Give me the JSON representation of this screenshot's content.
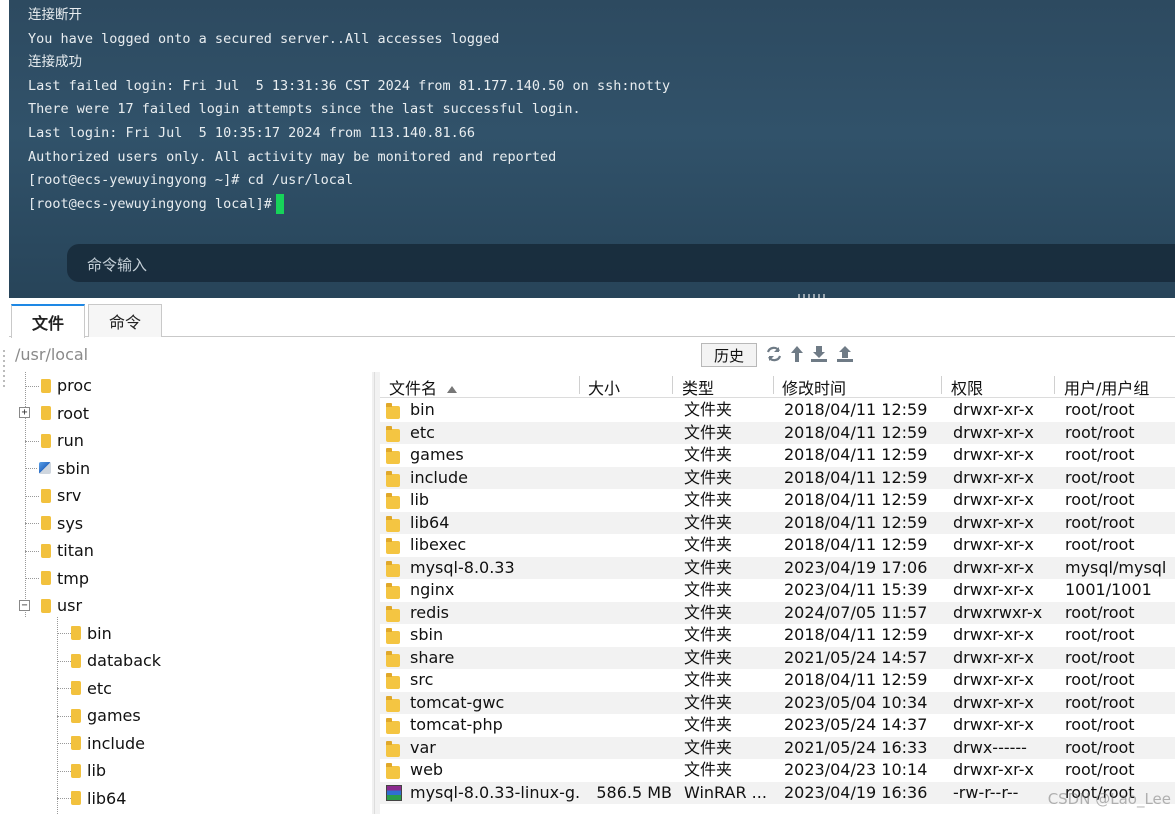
{
  "terminal": {
    "lines": [
      "连接断开",
      "You have logged onto a secured server..All accesses logged",
      "连接成功",
      "Last failed login: Fri Jul  5 13:31:36 CST 2024 from 81.177.140.50 on ssh:notty",
      "There were 17 failed login attempts since the last successful login.",
      "Last login: Fri Jul  5 10:35:17 2024 from 113.140.81.66",
      "Authorized users only. All activity may be monitored and reported",
      "[root@ecs-yewuyingyong ~]# cd /usr/local",
      "[root@ecs-yewuyingyong local]#"
    ],
    "command_placeholder": "命令输入",
    "cursor_color": "#17d35a"
  },
  "tabs": {
    "file": "文件",
    "command": "命令"
  },
  "pathbar": {
    "path": "/usr/local",
    "history_label": "历史"
  },
  "icons": {
    "refresh": "refresh-icon",
    "up": "arrow-up-icon",
    "download": "download-icon",
    "upload": "upload-icon"
  },
  "tree": {
    "items": [
      {
        "label": "proc"
      },
      {
        "label": "root"
      },
      {
        "label": "run"
      },
      {
        "label": "sbin"
      },
      {
        "label": "srv"
      },
      {
        "label": "sys"
      },
      {
        "label": "titan"
      },
      {
        "label": "tmp"
      },
      {
        "label": "usr"
      },
      {
        "label": "bin"
      },
      {
        "label": "databack"
      },
      {
        "label": "etc"
      },
      {
        "label": "games"
      },
      {
        "label": "include"
      },
      {
        "label": "lib"
      },
      {
        "label": "lib64"
      }
    ]
  },
  "filelist": {
    "columns": {
      "name": "文件名",
      "size": "大小",
      "type": "类型",
      "modified": "修改时间",
      "permissions": "权限",
      "owner": "用户/用户组"
    },
    "rows": [
      {
        "name": "bin",
        "size": "",
        "type": "文件夹",
        "modified": "2018/04/11 12:59",
        "permissions": "drwxr-xr-x",
        "owner": "root/root"
      },
      {
        "name": "etc",
        "size": "",
        "type": "文件夹",
        "modified": "2018/04/11 12:59",
        "permissions": "drwxr-xr-x",
        "owner": "root/root"
      },
      {
        "name": "games",
        "size": "",
        "type": "文件夹",
        "modified": "2018/04/11 12:59",
        "permissions": "drwxr-xr-x",
        "owner": "root/root"
      },
      {
        "name": "include",
        "size": "",
        "type": "文件夹",
        "modified": "2018/04/11 12:59",
        "permissions": "drwxr-xr-x",
        "owner": "root/root"
      },
      {
        "name": "lib",
        "size": "",
        "type": "文件夹",
        "modified": "2018/04/11 12:59",
        "permissions": "drwxr-xr-x",
        "owner": "root/root"
      },
      {
        "name": "lib64",
        "size": "",
        "type": "文件夹",
        "modified": "2018/04/11 12:59",
        "permissions": "drwxr-xr-x",
        "owner": "root/root"
      },
      {
        "name": "libexec",
        "size": "",
        "type": "文件夹",
        "modified": "2018/04/11 12:59",
        "permissions": "drwxr-xr-x",
        "owner": "root/root"
      },
      {
        "name": "mysql-8.0.33",
        "size": "",
        "type": "文件夹",
        "modified": "2023/04/19 17:06",
        "permissions": "drwxr-xr-x",
        "owner": "mysql/mysql"
      },
      {
        "name": "nginx",
        "size": "",
        "type": "文件夹",
        "modified": "2023/04/11 15:39",
        "permissions": "drwxr-xr-x",
        "owner": "1001/1001"
      },
      {
        "name": "redis",
        "size": "",
        "type": "文件夹",
        "modified": "2024/07/05 11:57",
        "permissions": "drwxrwxr-x",
        "owner": "root/root"
      },
      {
        "name": "sbin",
        "size": "",
        "type": "文件夹",
        "modified": "2018/04/11 12:59",
        "permissions": "drwxr-xr-x",
        "owner": "root/root"
      },
      {
        "name": "share",
        "size": "",
        "type": "文件夹",
        "modified": "2021/05/24 14:57",
        "permissions": "drwxr-xr-x",
        "owner": "root/root"
      },
      {
        "name": "src",
        "size": "",
        "type": "文件夹",
        "modified": "2018/04/11 12:59",
        "permissions": "drwxr-xr-x",
        "owner": "root/root"
      },
      {
        "name": "tomcat-gwc",
        "size": "",
        "type": "文件夹",
        "modified": "2023/05/04 10:34",
        "permissions": "drwxr-xr-x",
        "owner": "root/root"
      },
      {
        "name": "tomcat-php",
        "size": "",
        "type": "文件夹",
        "modified": "2023/05/24 14:37",
        "permissions": "drwxr-xr-x",
        "owner": "root/root"
      },
      {
        "name": "var",
        "size": "",
        "type": "文件夹",
        "modified": "2021/05/24 16:33",
        "permissions": "drwx------",
        "owner": "root/root"
      },
      {
        "name": "web",
        "size": "",
        "type": "文件夹",
        "modified": "2023/04/23 10:14",
        "permissions": "drwxr-xr-x",
        "owner": "root/root"
      },
      {
        "name": "mysql-8.0.33-linux-g...",
        "size": "586.5 MB",
        "type": "WinRAR ...",
        "modified": "2023/04/19 16:36",
        "permissions": "-rw-r--r--",
        "owner": "root/root"
      }
    ]
  },
  "watermark": "CSDN @Lao_Lee"
}
